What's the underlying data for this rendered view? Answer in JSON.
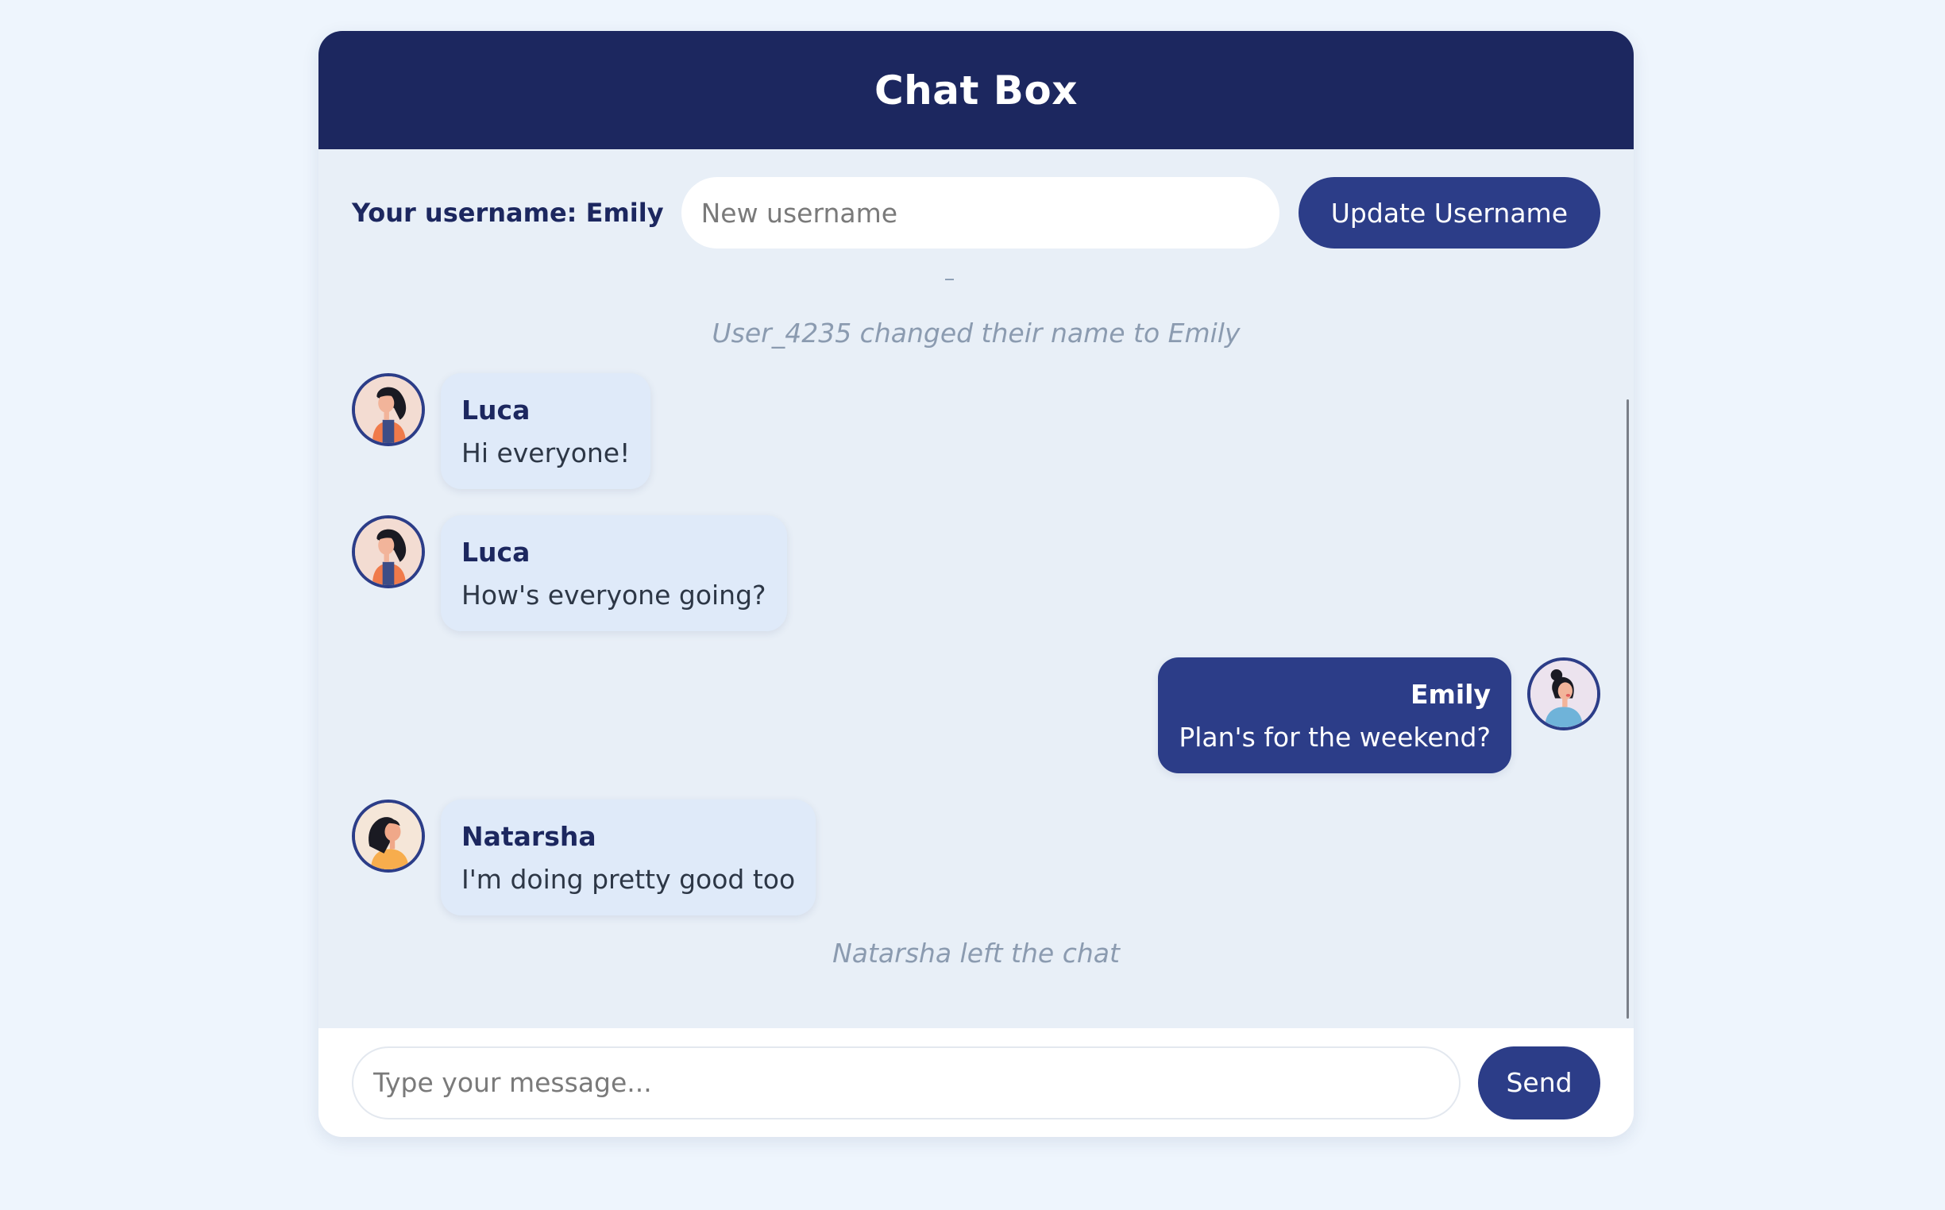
{
  "header": {
    "title": "Chat Box"
  },
  "username_bar": {
    "label": "Your username: Emily",
    "input_placeholder": "New username",
    "input_value": "",
    "update_button_label": "Update Username"
  },
  "messages": [
    {
      "kind": "system",
      "text": "User_4235 changed their name to Emily"
    },
    {
      "kind": "chat",
      "sender": "Luca",
      "text": "Hi everyone!",
      "mine": false,
      "avatar": "woman-orange-top-avatar"
    },
    {
      "kind": "chat",
      "sender": "Luca",
      "text": "How's everyone going?",
      "mine": false,
      "avatar": "woman-orange-top-avatar"
    },
    {
      "kind": "chat",
      "sender": "Emily",
      "text": "Plan's for the weekend?",
      "mine": true,
      "avatar": "woman-blue-top-avatar"
    },
    {
      "kind": "chat",
      "sender": "Natarsha",
      "text": "I'm doing pretty good too",
      "mine": false,
      "avatar": "woman-yellow-top-avatar"
    },
    {
      "kind": "system",
      "text": "Natarsha left the chat"
    }
  ],
  "composer": {
    "input_placeholder": "Type your message...",
    "input_value": "",
    "send_button_label": "Send"
  },
  "colors": {
    "page_background": "#eef5fd",
    "header_navy": "#1c275f",
    "accent_blue": "#2c3d88",
    "incoming_bubble": "#dfeaf9",
    "system_text": "#8b9bb0"
  }
}
